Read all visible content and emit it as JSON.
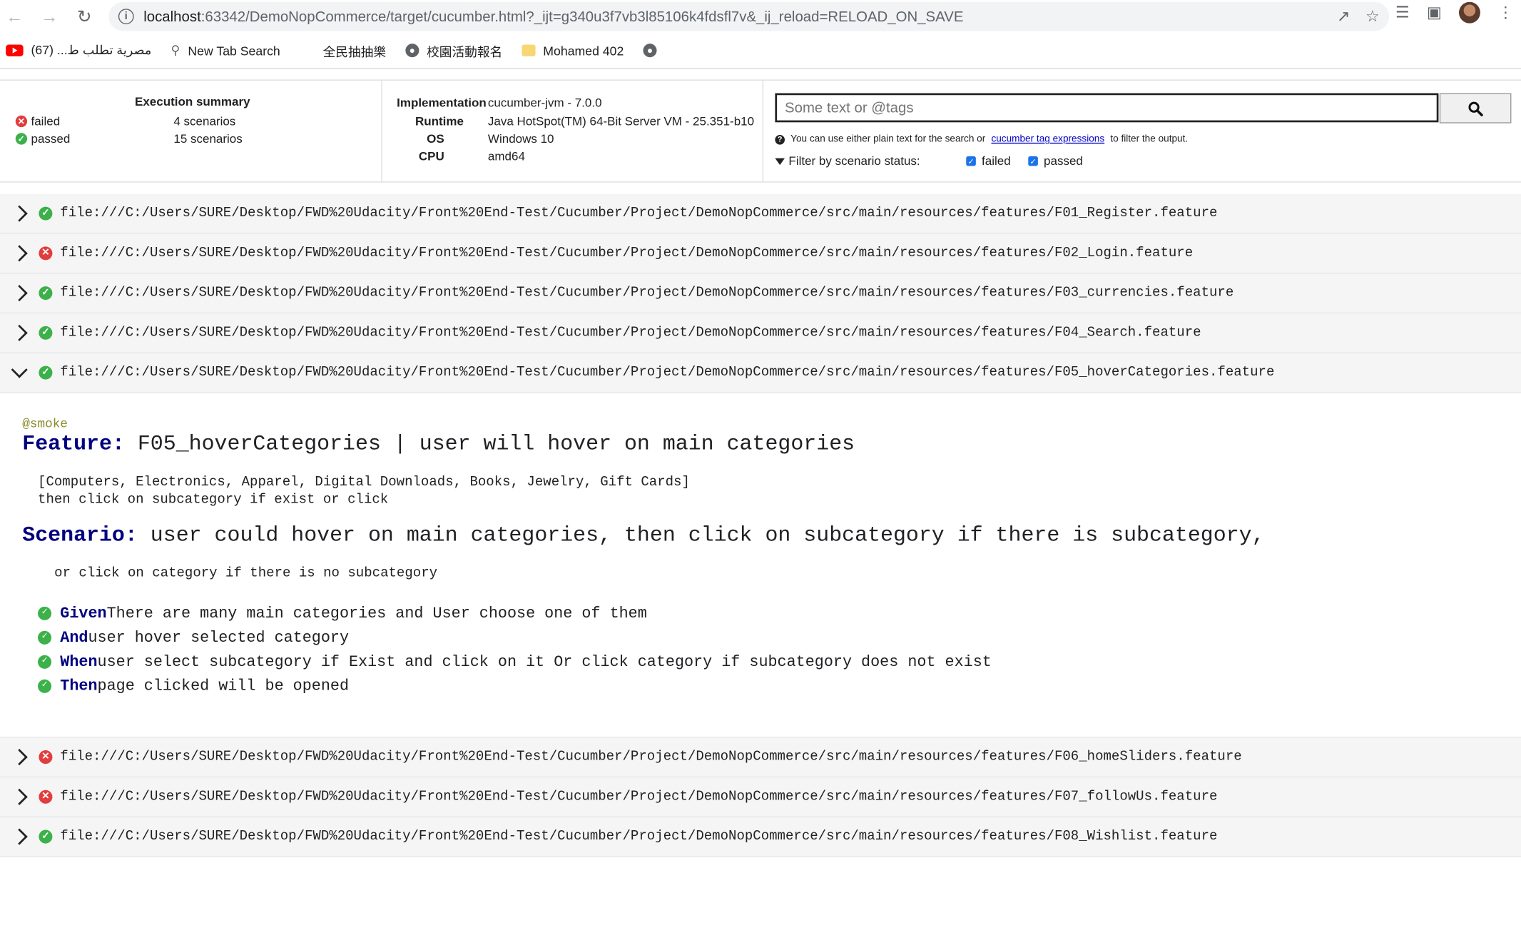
{
  "browser": {
    "url_host": "localhost",
    "url_rest": ":63342/DemoNopCommerce/target/cucumber.html?_ijt=g340u3f7vb3l85106k4fdsfl7v&_ij_reload=RELOAD_ON_SAVE"
  },
  "bookmarks": [
    {
      "label": "مصرية تطلب ط... (67)",
      "icon": "youtube-icon"
    },
    {
      "label": "New Tab Search",
      "icon": "search-icon"
    },
    {
      "label": "全民抽抽樂",
      "icon": "none"
    },
    {
      "label": "校園活動報名",
      "icon": "globe-icon"
    },
    {
      "label": "Mohamed 402",
      "icon": "folder-icon"
    }
  ],
  "summary": {
    "title": "Execution summary",
    "failed_label": "failed",
    "failed_count": "4 scenarios",
    "passed_label": "passed",
    "passed_count": "15 scenarios"
  },
  "env": {
    "implementation_key": "Implementation",
    "implementation_val": "cucumber-jvm - 7.0.0",
    "runtime_key": "Runtime",
    "runtime_val": "Java HotSpot(TM) 64-Bit Server VM - 25.351-b10",
    "os_key": "OS",
    "os_val": "Windows 10",
    "cpu_key": "CPU",
    "cpu_val": "amd64"
  },
  "search": {
    "placeholder": "Some text or @tags",
    "help_pre": "You can use either plain text for the search or",
    "help_link": "cucumber tag expressions",
    "help_post": "to filter the output.",
    "filter_label": "Filter by scenario status:",
    "filter_failed": "failed",
    "filter_passed": "passed"
  },
  "features": [
    {
      "status": "passed",
      "path": "file:///C:/Users/SURE/Desktop/FWD%20Udacity/Front%20End-Test/Cucumber/Project/DemoNopCommerce/src/main/resources/features/F01_Register.feature"
    },
    {
      "status": "failed",
      "path": "file:///C:/Users/SURE/Desktop/FWD%20Udacity/Front%20End-Test/Cucumber/Project/DemoNopCommerce/src/main/resources/features/F02_Login.feature"
    },
    {
      "status": "passed",
      "path": "file:///C:/Users/SURE/Desktop/FWD%20Udacity/Front%20End-Test/Cucumber/Project/DemoNopCommerce/src/main/resources/features/F03_currencies.feature"
    },
    {
      "status": "passed",
      "path": "file:///C:/Users/SURE/Desktop/FWD%20Udacity/Front%20End-Test/Cucumber/Project/DemoNopCommerce/src/main/resources/features/F04_Search.feature"
    },
    {
      "status": "passed",
      "path": "file:///C:/Users/SURE/Desktop/FWD%20Udacity/Front%20End-Test/Cucumber/Project/DemoNopCommerce/src/main/resources/features/F05_hoverCategories.feature"
    },
    {
      "status": "failed",
      "path": "file:///C:/Users/SURE/Desktop/FWD%20Udacity/Front%20End-Test/Cucumber/Project/DemoNopCommerce/src/main/resources/features/F06_homeSliders.feature"
    },
    {
      "status": "failed",
      "path": "file:///C:/Users/SURE/Desktop/FWD%20Udacity/Front%20End-Test/Cucumber/Project/DemoNopCommerce/src/main/resources/features/F07_followUs.feature"
    },
    {
      "status": "passed",
      "path": "file:///C:/Users/SURE/Desktop/FWD%20Udacity/Front%20End-Test/Cucumber/Project/DemoNopCommerce/src/main/resources/features/F08_Wishlist.feature"
    }
  ],
  "expanded": {
    "tag": "@smoke",
    "feature_kw": "Feature:",
    "feature_name": " F05_hoverCategories | user will hover on main categories",
    "description": "[Computers, Electronics, Apparel, Digital Downloads, Books, Jewelry, Gift Cards]\nthen click on subcategory if exist or click",
    "scenario_kw": "Scenario:",
    "scenario_name": " user could hover on main categories, then click on subcategory if there is subcategory,",
    "scenario_desc": "or click on category if there is no subcategory",
    "steps": [
      {
        "kw": "Given",
        "text": " There are many main categories and User choose one of them"
      },
      {
        "kw": "And",
        "text": " user hover selected category"
      },
      {
        "kw": "When",
        "text": " user select subcategory if Exist and click on it Or click category if subcategory does not exist"
      },
      {
        "kw": "Then",
        "text": " page clicked will be opened"
      }
    ]
  },
  "colors": {
    "failed": "#e23d3d",
    "passed": "#3cb14a",
    "keyword": "#000080"
  }
}
